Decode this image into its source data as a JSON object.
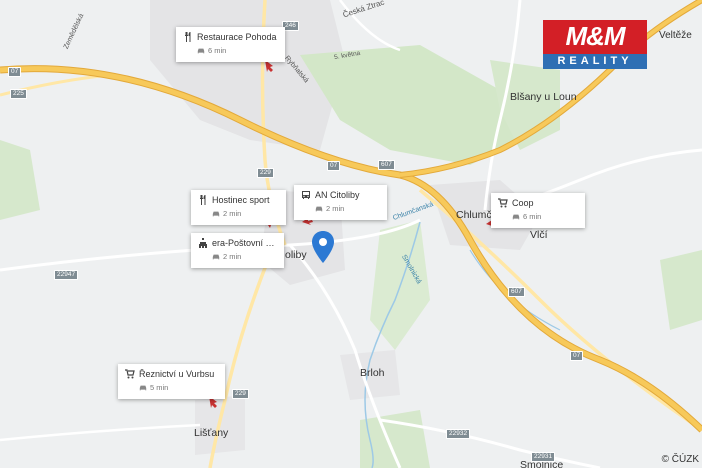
{
  "brand": {
    "top": "M&M",
    "bottom": "REALITY"
  },
  "copyright": "© ČÚZK",
  "place_labels": {
    "cestka": "Česká Ztrac",
    "velteze": "Veltěže",
    "blsany": "Blšany u Loun",
    "chlumcan": "Chlumčan",
    "vlci": "Vlčí",
    "citoliby": "oliby",
    "brloh": "Brloh",
    "listany": "Lišťany",
    "simolenice": "Smolnice",
    "zemedelska": "Zemědělská",
    "rybnalska": "Rybňalská",
    "kvetna": "5. května",
    "chlumcanska": "Chlumčanská",
    "smolnicka": "Smolnická"
  },
  "road_numbers": [
    "246",
    "07",
    "225",
    "229",
    "07",
    "607",
    "22947",
    "607",
    "07",
    "229",
    "22932",
    "22931"
  ],
  "pois": [
    {
      "name": "Restaurace Pohoda",
      "time": "6 min",
      "icon": "restaurant-icon"
    },
    {
      "name": "Hostinec sport",
      "time": "2 min",
      "icon": "restaurant-icon"
    },
    {
      "name": "AN Citoliby",
      "time": "2 min",
      "icon": "bus-icon"
    },
    {
      "name": "era-Poštovní spoř...",
      "time": "2 min",
      "icon": "bank-icon"
    },
    {
      "name": "Coop",
      "time": "6 min",
      "icon": "shopping-cart-icon"
    },
    {
      "name": "Řeznictví u Vurbsu",
      "time": "5 min",
      "icon": "shopping-cart-icon"
    }
  ],
  "colors": {
    "pin": "#2c79d3",
    "brand_red": "#d31f26",
    "brand_blue": "#2e6fb4",
    "highway": "#f7c95a",
    "road": "#ffe7a6",
    "water": "#9dc9e6",
    "forest": "#cfe4c4"
  }
}
